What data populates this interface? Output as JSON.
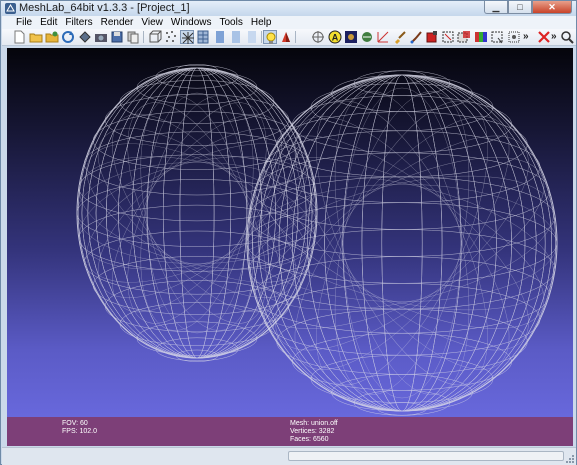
{
  "window": {
    "title": "MeshLab_64bit v1.3.3 - [Project_1]"
  },
  "menu": [
    "File",
    "Edit",
    "Filters",
    "Render",
    "View",
    "Windows",
    "Tools",
    "Help"
  ],
  "toolbar": {
    "buttons": [
      "new-project",
      "open-project",
      "import-mesh",
      "reload",
      "export-mesh",
      "snapshot",
      "save",
      "copy",
      "bounding-box",
      "points",
      "wireframe",
      "flat-lines",
      "flat",
      "smooth",
      "texture",
      "light",
      "color",
      "align",
      "annotate",
      "raster",
      "measure",
      "edit-tools",
      "paint",
      "select",
      "select-vertices",
      "select-faces",
      "invert-selection",
      "color-select",
      "pick",
      "delete",
      "search"
    ],
    "overflow_glyph": "»"
  },
  "info": {
    "fov": "FOV: 60",
    "fps": "FPS:   102.0",
    "mesh": "Mesh: union.off",
    "vertices": "Vertices: 3282",
    "faces": "Faces: 6560"
  },
  "colors": {
    "info_bg": "#7d3f78",
    "viewport_top": "#05050b",
    "viewport_bottom": "#6868dc",
    "wire": "#d8d8e8"
  }
}
